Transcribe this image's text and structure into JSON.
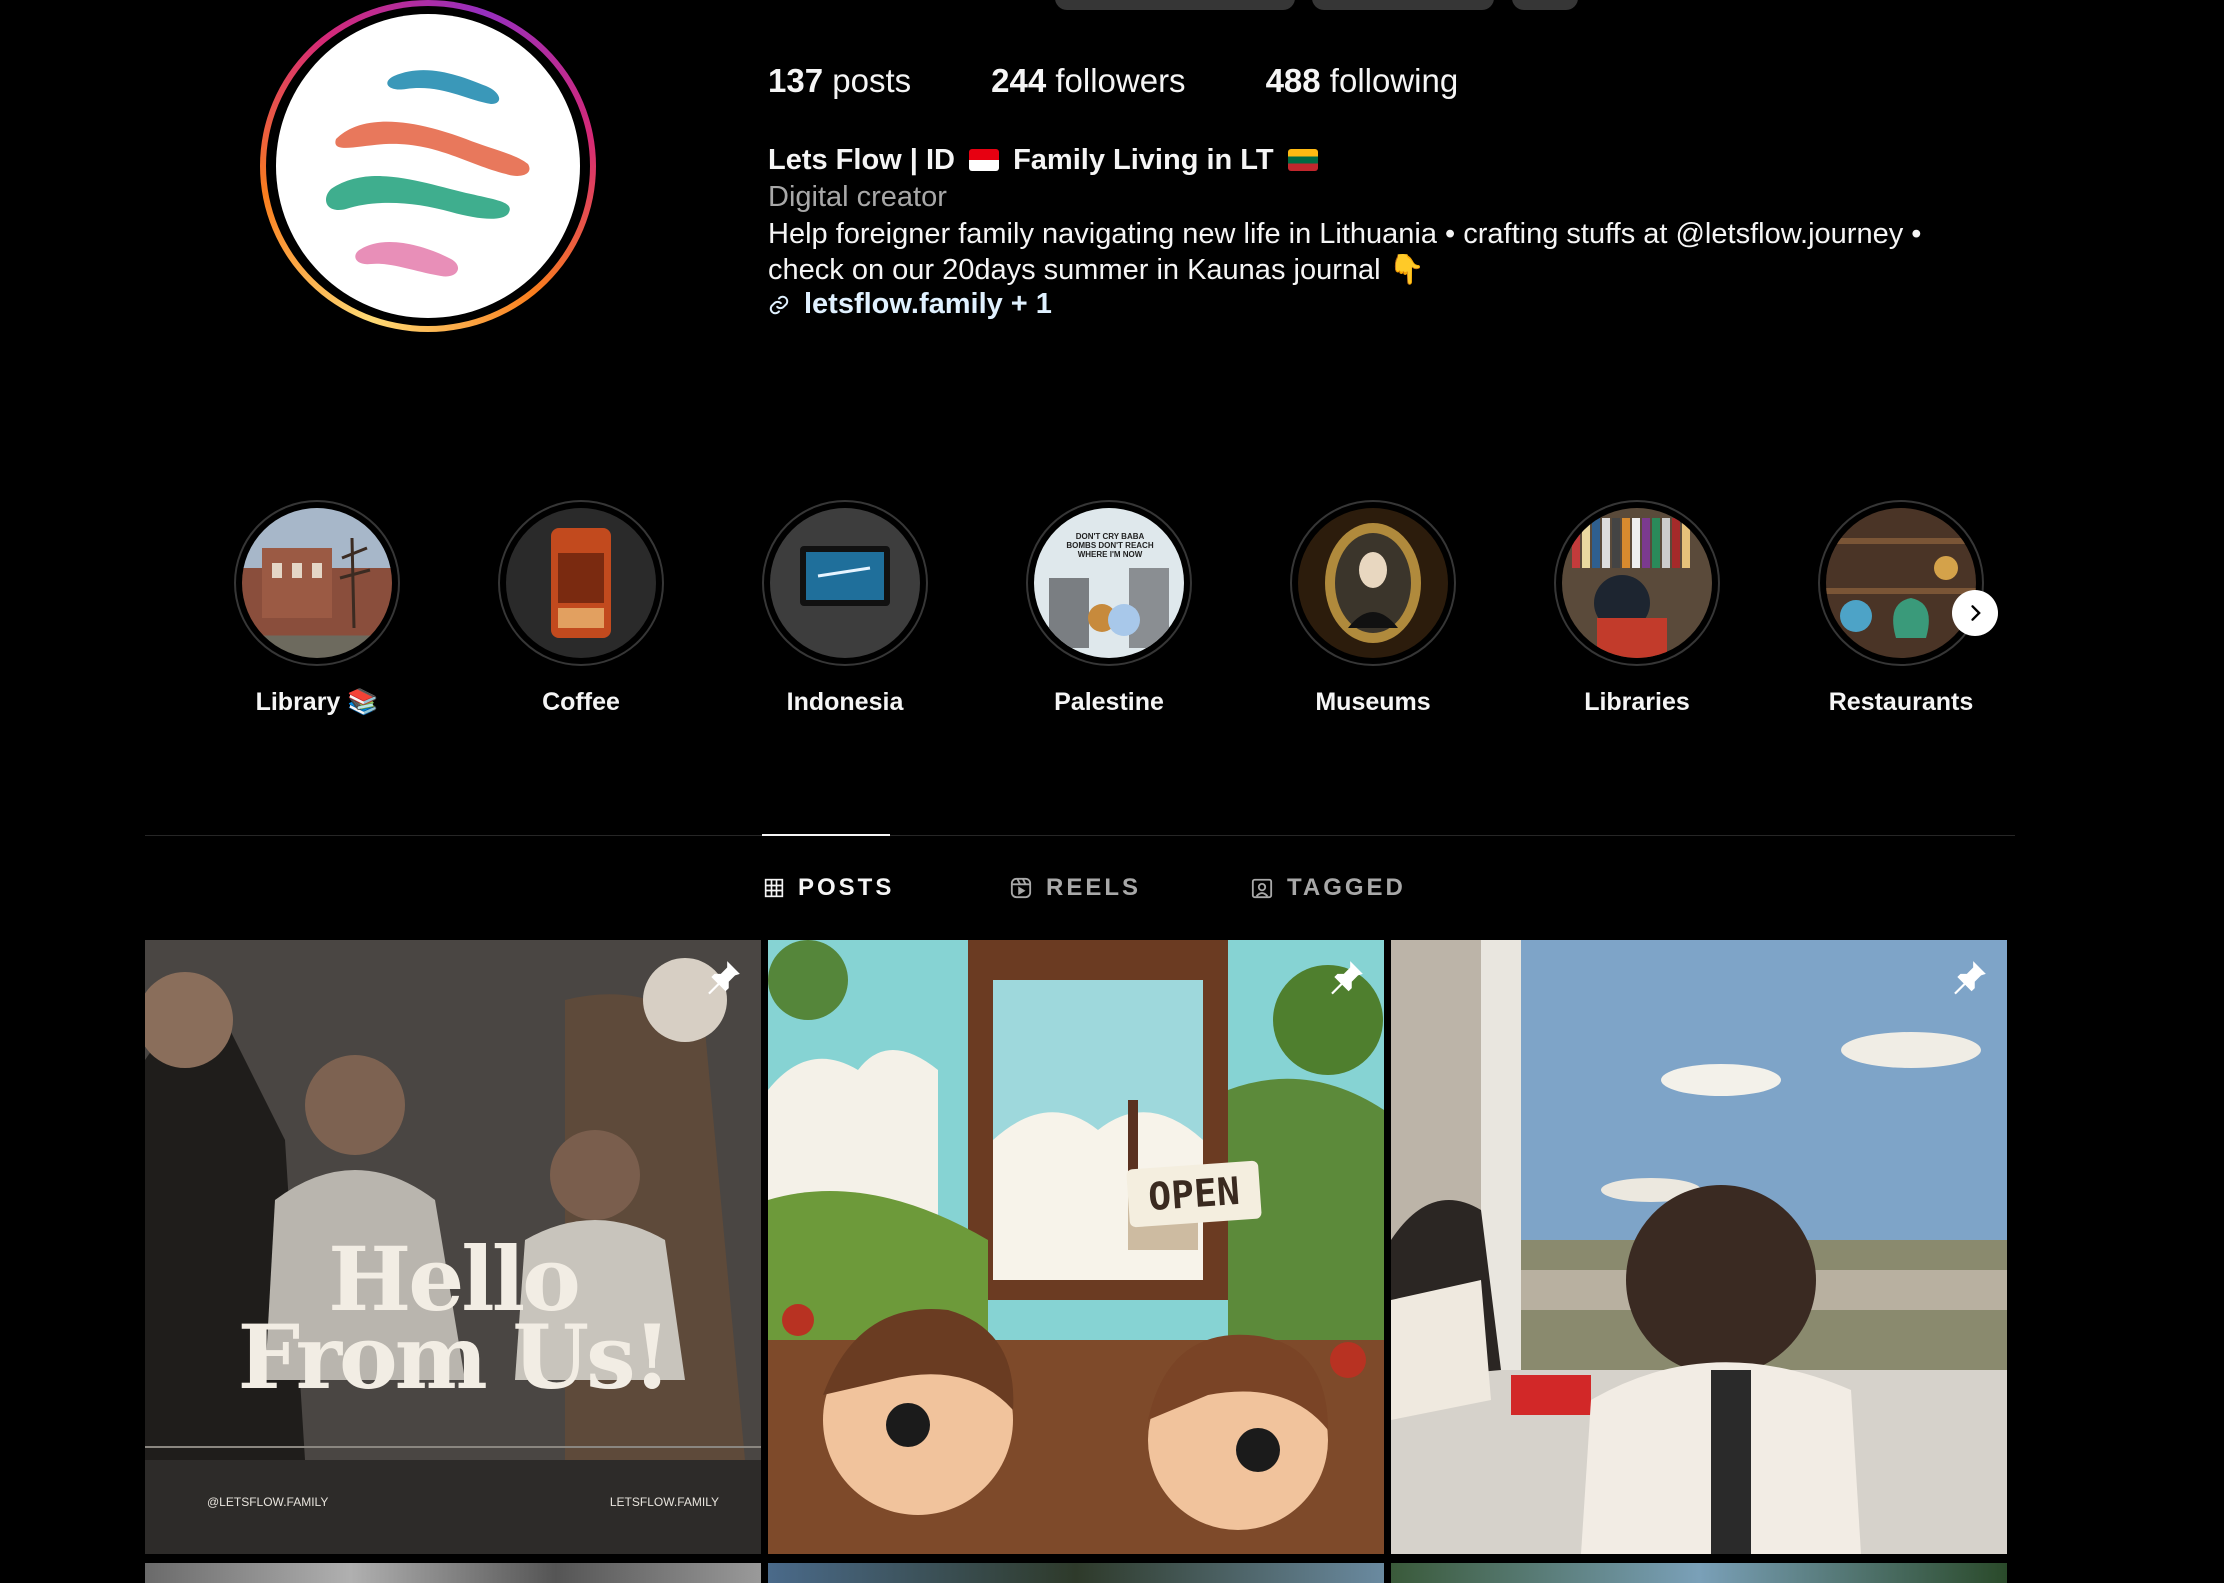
{
  "profile": {
    "stats": {
      "posts_count": "137",
      "posts_label": "posts",
      "followers_count": "244",
      "followers_label": "followers",
      "following_count": "488",
      "following_label": "following"
    },
    "name_part1": "Lets Flow | ID",
    "name_part2": "Family Living in LT",
    "category": "Digital creator",
    "bio_line1": "Help foreigner family navigating new life in Lithuania • crafting stuffs at @letsflow.journey •",
    "bio_line2": "check on our 20days summer in Kaunas journal",
    "bio_emoji": "👇",
    "link_text": "letsflow.family + 1"
  },
  "highlights": [
    {
      "label": "Library 📚"
    },
    {
      "label": "Coffee"
    },
    {
      "label": "Indonesia"
    },
    {
      "label": "Palestine"
    },
    {
      "label": "Museums"
    },
    {
      "label": "Libraries"
    },
    {
      "label": "Restaurants"
    }
  ],
  "highlight_palestine_text": "DON'T CRY BABA BOMBS DON'T REACH WHERE I'M NOW",
  "tabs": {
    "posts": "POSTS",
    "reels": "REELS",
    "tagged": "TAGGED"
  },
  "posts": {
    "post1": {
      "title_line1": "Hello",
      "title_line2": "From Us!",
      "footer_left": "@LETSFLOW.FAMILY",
      "footer_right": "LETSFLOW.FAMILY"
    },
    "post2": {
      "sign_text": "OPEN"
    }
  },
  "colors": {
    "background": "#000000",
    "text": "#f5f5f5",
    "muted": "#a8a8a8",
    "link": "#e0f1ff",
    "divider": "#262626"
  },
  "icons": {
    "link": "link-icon",
    "posts_tab": "grid-icon",
    "reels_tab": "reels-icon",
    "tagged_tab": "tagged-icon",
    "pin": "pin-icon",
    "next": "chevron-right-icon"
  }
}
